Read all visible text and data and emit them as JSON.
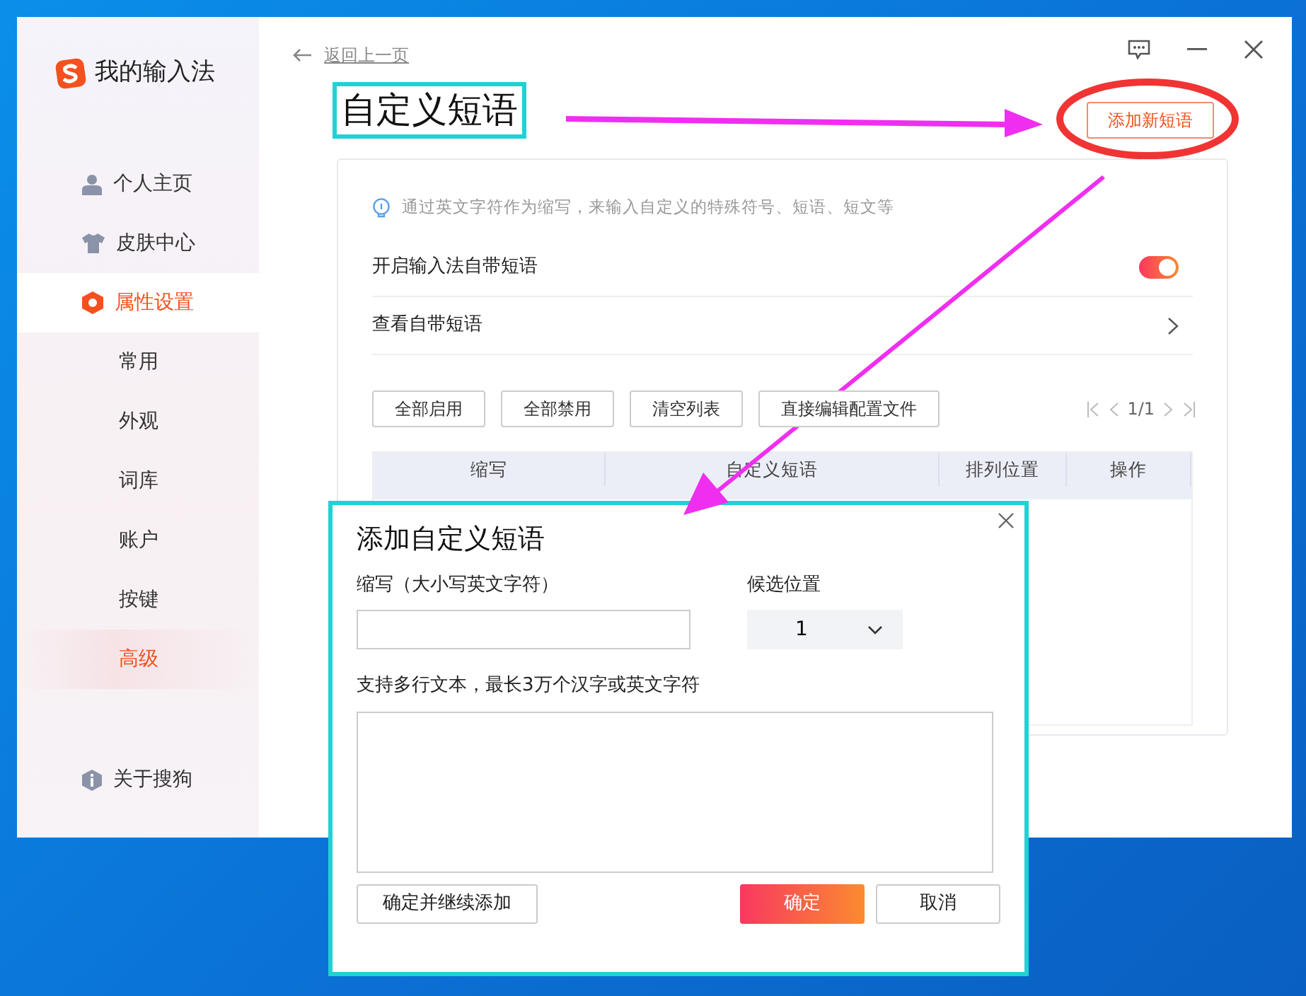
{
  "app": {
    "logo_text": "我的输入法"
  },
  "sidebar": {
    "items": [
      {
        "label": "个人主页",
        "selected": false
      },
      {
        "label": "皮肤中心",
        "selected": false
      },
      {
        "label": "属性设置",
        "selected": true,
        "children": [
          {
            "label": "常用",
            "selected": false
          },
          {
            "label": "外观",
            "selected": false
          },
          {
            "label": "词库",
            "selected": false
          },
          {
            "label": "账户",
            "selected": false
          },
          {
            "label": "按键",
            "selected": false
          },
          {
            "label": "高级",
            "selected": true
          }
        ]
      }
    ],
    "footer_item": {
      "label": "关于搜狗"
    }
  },
  "back_link": "返回上一页",
  "page_title": "自定义短语",
  "add_button": "添加新短语",
  "panel": {
    "hint": "通过英文字符作为缩写，来输入自定义的特殊符号、短语、短文等",
    "settings": [
      {
        "kind": "toggle",
        "label": "开启输入法自带短语",
        "on": true
      },
      {
        "kind": "link",
        "label": "查看自带短语"
      }
    ],
    "toolbar_buttons": [
      "全部启用",
      "全部禁用",
      "清空列表",
      "直接编辑配置文件"
    ],
    "pagination": "1/1",
    "table": {
      "columns": [
        "缩写",
        "自定义短语",
        "排列位置",
        "操作"
      ]
    }
  },
  "dialog": {
    "title": "添加自定义短语",
    "abbr_label": "缩写（大小写英文字符）",
    "position_label": "候选位置",
    "position_value": "1",
    "content_label": "支持多行文本，最长3万个汉字或英文字符",
    "buttons": [
      {
        "label": "确定并继续添加",
        "kind": "secondary"
      },
      {
        "label": "确定",
        "kind": "primary"
      },
      {
        "label": "取消",
        "kind": "secondary"
      }
    ]
  }
}
